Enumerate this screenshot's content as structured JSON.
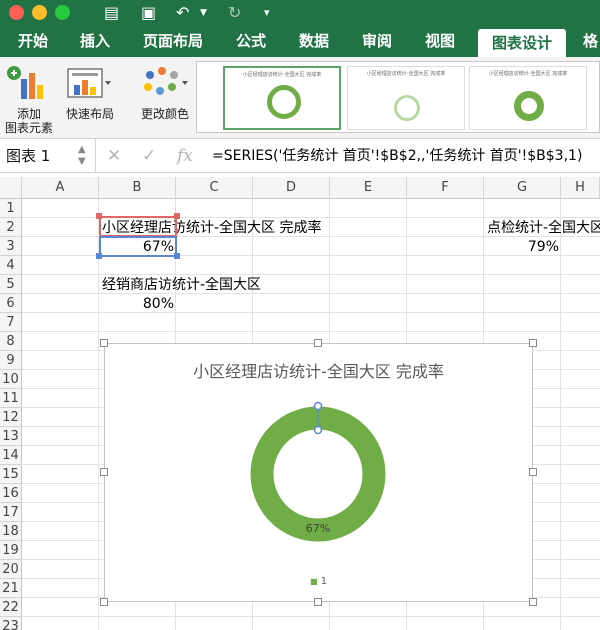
{
  "window": {
    "colors": {
      "excel_green": "#217346"
    }
  },
  "ribbon_tabs": [
    "开始",
    "插入",
    "页面布局",
    "公式",
    "数据",
    "审阅",
    "视图",
    "图表设计",
    "格"
  ],
  "ribbon": {
    "add_chart_element": "添加\n图表元素",
    "quick_layout": "快速布局",
    "change_colors": "更改颜色",
    "thumb_titles": [
      "小区经理店访统计-全国大区 完成率",
      "小区经理店访统计-全国大区 完成率",
      "小区经理店访统计-全国大区 完成率"
    ]
  },
  "formula_bar": {
    "name_box": "图表 1",
    "formula": "=SERIES('任务统计 首页'!$B$2,,'任务统计 首页'!$B$3,1)"
  },
  "sheet": {
    "columns": [
      "A",
      "B",
      "C",
      "D",
      "E",
      "F",
      "G",
      "H"
    ],
    "rows": [
      "1",
      "2",
      "3",
      "4",
      "5",
      "6",
      "7",
      "8",
      "9",
      "10",
      "11",
      "12",
      "13",
      "14",
      "15",
      "16",
      "17",
      "18",
      "19",
      "20",
      "21",
      "22",
      "23"
    ],
    "cells": {
      "B2": "小区经理店访统计-全国大区 完成率",
      "B3": "67%",
      "B5": "经销商店访统计-全国大区",
      "B6": "80%",
      "G2": "点检统计-全国大区",
      "G3": "79%"
    }
  },
  "chart": {
    "colors": {
      "ring": "#70ad47"
    },
    "chart_data": {
      "type": "pie",
      "title": "小区经理店访统计-全国大区 完成率",
      "categories": [
        "1"
      ],
      "values": [
        0.67
      ],
      "data_labels": [
        "67%"
      ],
      "legend": [
        "1"
      ],
      "legend_position": "bottom"
    }
  }
}
